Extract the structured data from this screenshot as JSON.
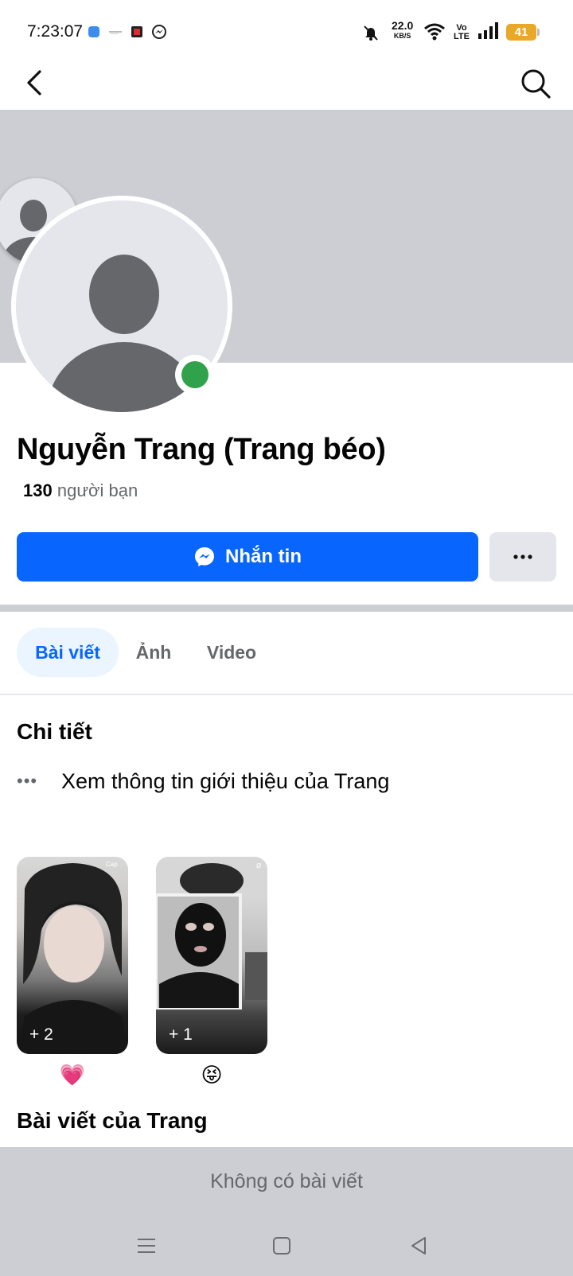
{
  "status_bar": {
    "time": "7:23:07",
    "net_speed": "22.0",
    "net_speed_unit": "KB/S",
    "volte": "Vo\nLTE",
    "battery": "41"
  },
  "profile": {
    "name": "Nguyễn Trang (Trang béo)",
    "friends_count": "130",
    "friends_label": "người bạn"
  },
  "actions": {
    "message_label": "Nhắn tin",
    "more_label": "···"
  },
  "tabs": [
    {
      "label": "Bài viết",
      "active": true
    },
    {
      "label": "Ảnh",
      "active": false
    },
    {
      "label": "Video",
      "active": false
    }
  ],
  "details": {
    "title": "Chi tiết",
    "intro_dots": "•••",
    "intro_text": "Xem thông tin giới thiệu của Trang"
  },
  "stories": [
    {
      "count": "+ 2",
      "emoji": "💗"
    },
    {
      "count": "+ 1",
      "emoji": "😝"
    }
  ],
  "posts": {
    "title": "Bài viết của Trang",
    "empty_text": "Không có bài viết"
  },
  "colors": {
    "accent": "#0866ff",
    "online": "#31a24c",
    "cover": "#ccced3"
  }
}
